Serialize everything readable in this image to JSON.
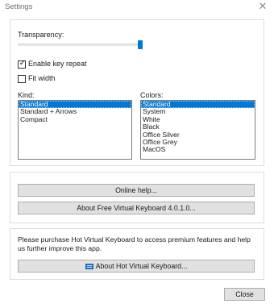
{
  "window": {
    "title": "Settings",
    "close_glyph": "✕"
  },
  "transparency": {
    "label": "Transparency:",
    "value_fraction": 1.0
  },
  "options": {
    "enable_key_repeat": {
      "label": "Enable key repeat",
      "checked": true
    },
    "fit_width": {
      "label": "Fit width",
      "checked": false
    }
  },
  "kind": {
    "label": "Kind:",
    "items": [
      "Standard",
      "Standard + Arrows",
      "Compact"
    ],
    "selected": "Standard"
  },
  "colors": {
    "label": "Colors:",
    "items": [
      "Standard",
      "System",
      "White",
      "Black",
      "Office Silver",
      "Office Grey",
      "MacOS"
    ],
    "selected": "Standard"
  },
  "help": {
    "online_help_label": "Online help...",
    "about_free_label": "About Free Virtual Keyboard 4.0.1.0..."
  },
  "premium": {
    "message": "Please purchase Hot Virtual Keyboard to access premium features and help us further improve this app.",
    "about_hot_label": "About Hot Virtual Keyboard...",
    "about_hot_icon": "keyboard-icon"
  },
  "footer": {
    "close_label": "Close"
  },
  "colors_theme": {
    "accent": "#0078d7",
    "button_bg": "#e1e1e1",
    "button_border": "#adadad"
  }
}
